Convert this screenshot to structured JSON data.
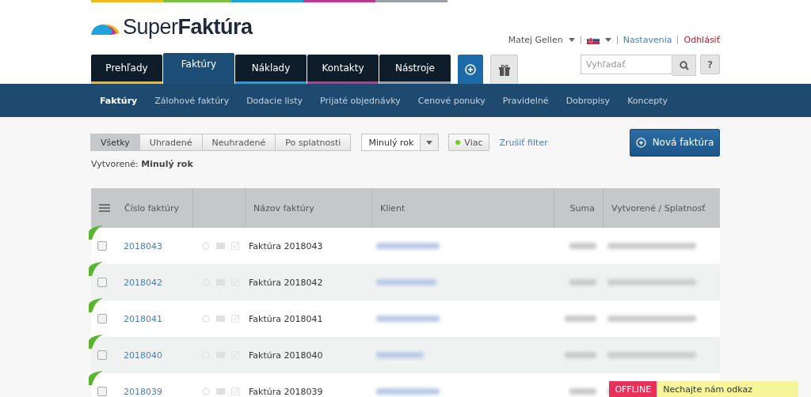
{
  "logo": {
    "light": "Super",
    "bold": "Faktúra"
  },
  "user": {
    "name": "Matej Gellen",
    "settings": "Nastavenia",
    "logout": "Odhlásiť"
  },
  "tabs": [
    {
      "label": "Prehľady",
      "selected": false,
      "color": "#f2b81c"
    },
    {
      "label": "Faktúry",
      "selected": true,
      "color": "#7cc242"
    },
    {
      "label": "Náklady",
      "selected": false,
      "color": "#1fa3dc"
    },
    {
      "label": "Kontakty",
      "selected": false,
      "color": "#c2388f"
    },
    {
      "label": "Nástroje",
      "selected": false,
      "color": "#9aa0a4"
    }
  ],
  "search": {
    "placeholder": "Vyhľadať"
  },
  "help_button": "?",
  "subnav": [
    {
      "label": "Faktúry",
      "selected": true
    },
    {
      "label": "Zálohové faktúry",
      "selected": false
    },
    {
      "label": "Dodacie listy",
      "selected": false
    },
    {
      "label": "Prijaté objednávky",
      "selected": false
    },
    {
      "label": "Cenové ponuky",
      "selected": false
    },
    {
      "label": "Pravidelné",
      "selected": false
    },
    {
      "label": "Dobropisy",
      "selected": false
    },
    {
      "label": "Koncepty",
      "selected": false
    }
  ],
  "filter": {
    "status_buttons": [
      {
        "label": "Všetky",
        "selected": true
      },
      {
        "label": "Uhradené",
        "selected": false
      },
      {
        "label": "Neuhradené",
        "selected": false
      },
      {
        "label": "Po splatnosti",
        "selected": false
      }
    ],
    "period": "Minulý rok",
    "more_button": "Viac",
    "more_active": true,
    "clear": "Zrušiť filter"
  },
  "created_filter": "Vytvorené: **Minulý rok**",
  "new_invoice_button": "Nová faktúra",
  "table": {
    "columns": [
      "Číslo faktúry",
      "Názov faktúry",
      "Klient",
      "Suma",
      "Vytvorené / Splatnosť"
    ],
    "rows": [
      {
        "number": "2018043",
        "name": "Faktúra 2018043",
        "checked": false,
        "color": "#5ab52e"
      },
      {
        "number": "2018042",
        "name": "Faktúra 2018042",
        "checked": false,
        "color": "#5ab52e"
      },
      {
        "number": "2018041",
        "name": "Faktúra 2018041",
        "checked": false,
        "color": "#5ab52e"
      },
      {
        "number": "2018040",
        "name": "Faktúra 2018040",
        "checked": false,
        "color": "#5ab52e"
      },
      {
        "number": "2018039",
        "name": "Faktúra 2018039",
        "checked": false,
        "color": "#5ab52e"
      }
    ]
  },
  "chat": {
    "status": "OFFLINE",
    "message": "Nechajte nám odkaz"
  }
}
